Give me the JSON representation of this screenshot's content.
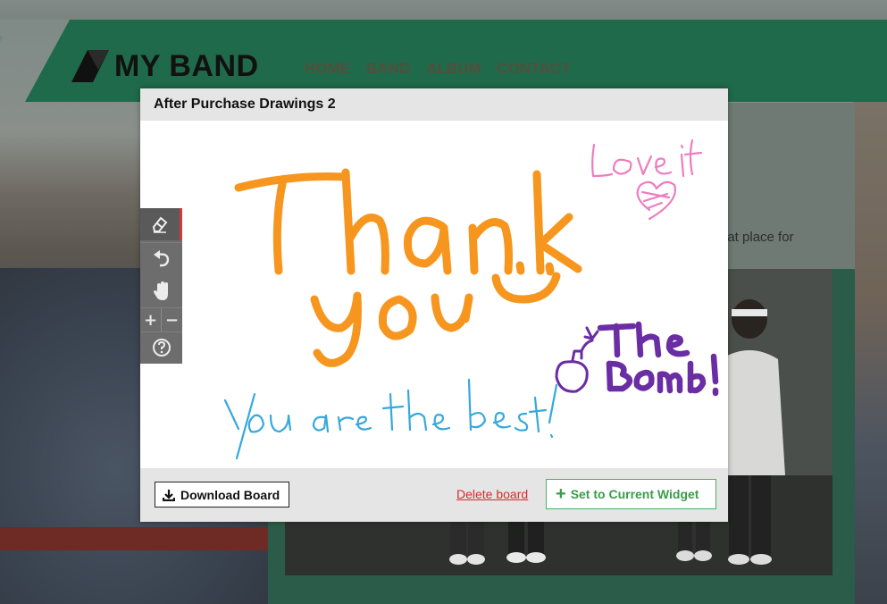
{
  "site": {
    "logo_text": "MY BAND",
    "nav": [
      "HOME",
      "BAND",
      "ALBUM",
      "CONTACT"
    ],
    "content_snippet": "eat place for"
  },
  "modal": {
    "title": "After Purchase Drawings 2",
    "drawing_texts": [
      "Thank you",
      "Love it",
      "The Bomb!",
      "You are the best!"
    ],
    "download_label": "Download Board",
    "delete_label": "Delete board",
    "set_widget_label": "Set to Current Widget"
  },
  "toolbar": {
    "tools": [
      "eraser-icon",
      "undo-icon",
      "hand-icon",
      "zoom-in-icon",
      "zoom-out-icon",
      "help-icon"
    ],
    "zoom_in": "+",
    "zoom_out": "−"
  },
  "colors": {
    "header_green": "#1f6a4b",
    "orange_ink": "#f6961e",
    "pink_ink": "#ee7cc0",
    "purple_ink": "#6a2da3",
    "blue_ink": "#36a8dc",
    "set_button_green": "#3a9b4c",
    "delete_red": "#d52b2b"
  }
}
